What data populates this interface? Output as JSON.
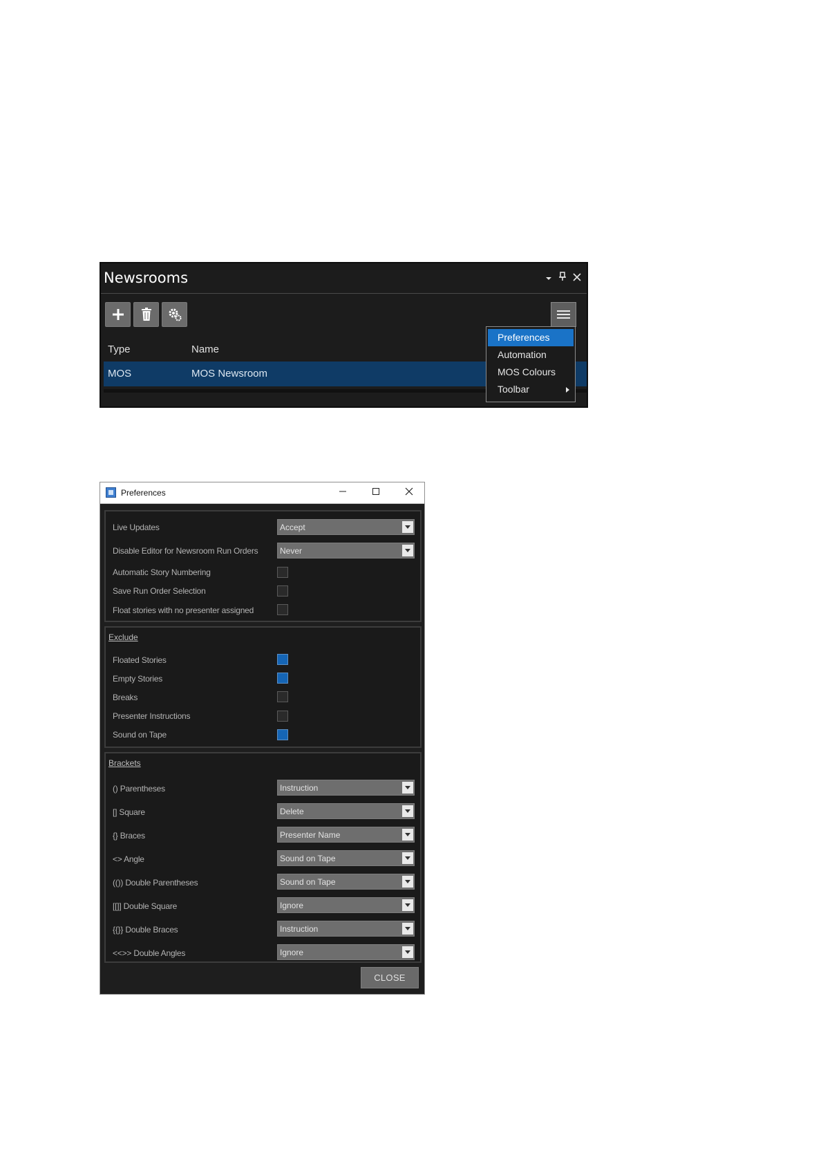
{
  "newsrooms": {
    "title": "Newsrooms",
    "title_icons": [
      "dropdown-arrow-icon",
      "pin-icon",
      "close-icon"
    ],
    "toolbar": [
      "add-icon",
      "delete-icon",
      "settings-icon"
    ],
    "columns": {
      "type": "Type",
      "name": "Name"
    },
    "rows": [
      {
        "type": "MOS",
        "name": "MOS Newsroom"
      }
    ]
  },
  "context_menu": {
    "items": [
      {
        "label": "Preferences",
        "active": true
      },
      {
        "label": "Automation"
      },
      {
        "label": "MOS Colours"
      },
      {
        "label": "Toolbar",
        "submenu": true
      }
    ]
  },
  "preferences": {
    "title": "Preferences",
    "general": [
      {
        "label": "Live Updates",
        "kind": "combo",
        "value": "Accept"
      },
      {
        "label": "Disable Editor for Newsroom Run Orders",
        "kind": "combo",
        "value": "Never"
      },
      {
        "label": "Automatic Story Numbering",
        "kind": "check",
        "checked": false
      },
      {
        "label": "Save Run Order Selection",
        "kind": "check",
        "checked": false
      },
      {
        "label": "Float stories with no presenter assigned",
        "kind": "check",
        "checked": false
      }
    ],
    "exclude": {
      "title": "Exclude",
      "items": [
        {
          "label": "Floated Stories",
          "checked": true
        },
        {
          "label": "Empty Stories",
          "checked": true
        },
        {
          "label": "Breaks",
          "checked": false
        },
        {
          "label": "Presenter Instructions",
          "checked": false
        },
        {
          "label": "Sound on Tape",
          "checked": true
        }
      ]
    },
    "brackets": {
      "title": "Brackets",
      "items": [
        {
          "label": "() Parentheses",
          "value": "Instruction"
        },
        {
          "label": "[] Square",
          "value": "Delete"
        },
        {
          "label": "{} Braces",
          "value": "Presenter Name"
        },
        {
          "label": "<> Angle",
          "value": "Sound on Tape"
        },
        {
          "label": "(()) Double Parentheses",
          "value": "Sound on Tape"
        },
        {
          "label": "[[]] Double Square",
          "value": "Ignore"
        },
        {
          "label": "{{}} Double Braces",
          "value": "Instruction"
        },
        {
          "label": "<<>> Double Angles",
          "value": "Ignore"
        }
      ]
    },
    "close_label": "CLOSE"
  },
  "colors": {
    "selection": "#0f3b66",
    "menu_highlight": "#1a73c7",
    "checkbox_on": "#1565b5"
  }
}
